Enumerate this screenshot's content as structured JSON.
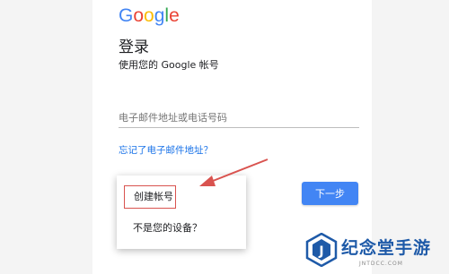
{
  "logo": {
    "letters": [
      "G",
      "o",
      "o",
      "g",
      "l",
      "e"
    ],
    "colors": [
      "#4285F4",
      "#EA4335",
      "#FBBC05",
      "#4285F4",
      "#34A853",
      "#EA4335"
    ]
  },
  "header": {
    "title": "登录",
    "subtitle": "使用您的 Google 帐号"
  },
  "form": {
    "email_placeholder": "电子邮件地址或电话号码",
    "forgot_link": "忘记了电子邮件地址？",
    "next_label": "下一步"
  },
  "popup_menu": {
    "items": [
      {
        "label": "创建帐号"
      },
      {
        "label": "不是您的设备？"
      }
    ]
  },
  "watermark": {
    "brand_text": "纪念堂手游",
    "url_text": "JNTDCC.COM",
    "icon_letter": "J"
  },
  "colors": {
    "accent_blue": "#4285f4",
    "link_blue": "#1a73e8",
    "annotation_red": "#d9534f",
    "brand_blue": "#1e5aa8"
  }
}
